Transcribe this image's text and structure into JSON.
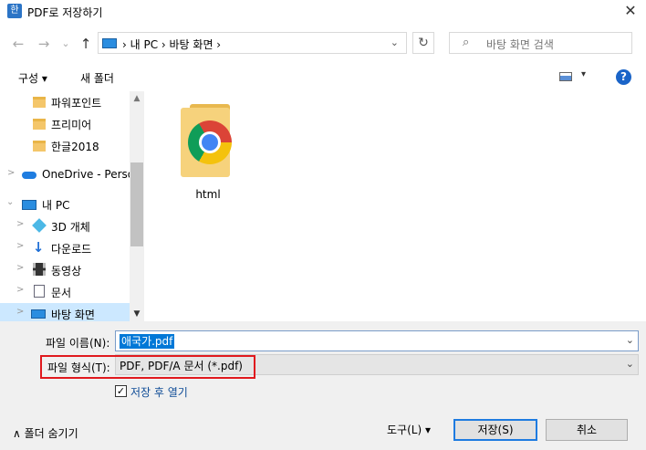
{
  "window": {
    "title": "PDF로 저장하기",
    "app_icon_text": "한",
    "close_glyph": "✕"
  },
  "nav": {
    "back": "←",
    "forward": "→",
    "recent": "⌄",
    "up": "↑",
    "breadcrumb": "› 내 PC › 바탕 화면 ›",
    "address_dropdown": "⌄",
    "refresh": "↻",
    "search_icon": "⌕",
    "search_placeholder": "바탕 화면 검색"
  },
  "toolbar": {
    "organize": "구성 ▾",
    "new_folder": "새 폴더",
    "view_dropdown": "▾",
    "help": "?"
  },
  "tree": [
    {
      "label": "파워포인트",
      "icon": "folder-icon"
    },
    {
      "label": "프리미어",
      "icon": "folder-icon"
    },
    {
      "label": "한글2018",
      "icon": "folder-icon"
    },
    {
      "label": "OneDrive - Person",
      "icon": "onedrive-icon",
      "arrow": ">"
    },
    {
      "label": "내 PC",
      "icon": "pc-icon",
      "arrow": "⌄"
    },
    {
      "label": "3D 개체",
      "icon": "3d-objects-icon",
      "arrow": ">"
    },
    {
      "label": "다운로드",
      "icon": "download-icon",
      "arrow": ">"
    },
    {
      "label": "동영상",
      "icon": "video-icon",
      "arrow": ">"
    },
    {
      "label": "문서",
      "icon": "document-icon",
      "arrow": ">"
    },
    {
      "label": "바탕 화면",
      "icon": "desktop-icon",
      "arrow": ">"
    }
  ],
  "scroll": {
    "up": "▲",
    "down": "▼"
  },
  "files": [
    {
      "name": "html",
      "icon": "chrome-folder-icon"
    }
  ],
  "form": {
    "filename_label": "파일 이름(N):",
    "filename_value": "애국가.pdf",
    "filetype_label": "파일 형식(T):",
    "filetype_value": "PDF, PDF/A 문서 (*.pdf)",
    "dropdown": "⌄",
    "open_after_save_label": "저장 후 열기",
    "open_after_save_checked": true,
    "checkmark": "✓"
  },
  "footer": {
    "hide_folders": "∧  폴더 숨기기",
    "tools": "도구(L)   ▾",
    "save": "저장(S)",
    "cancel": "취소"
  }
}
